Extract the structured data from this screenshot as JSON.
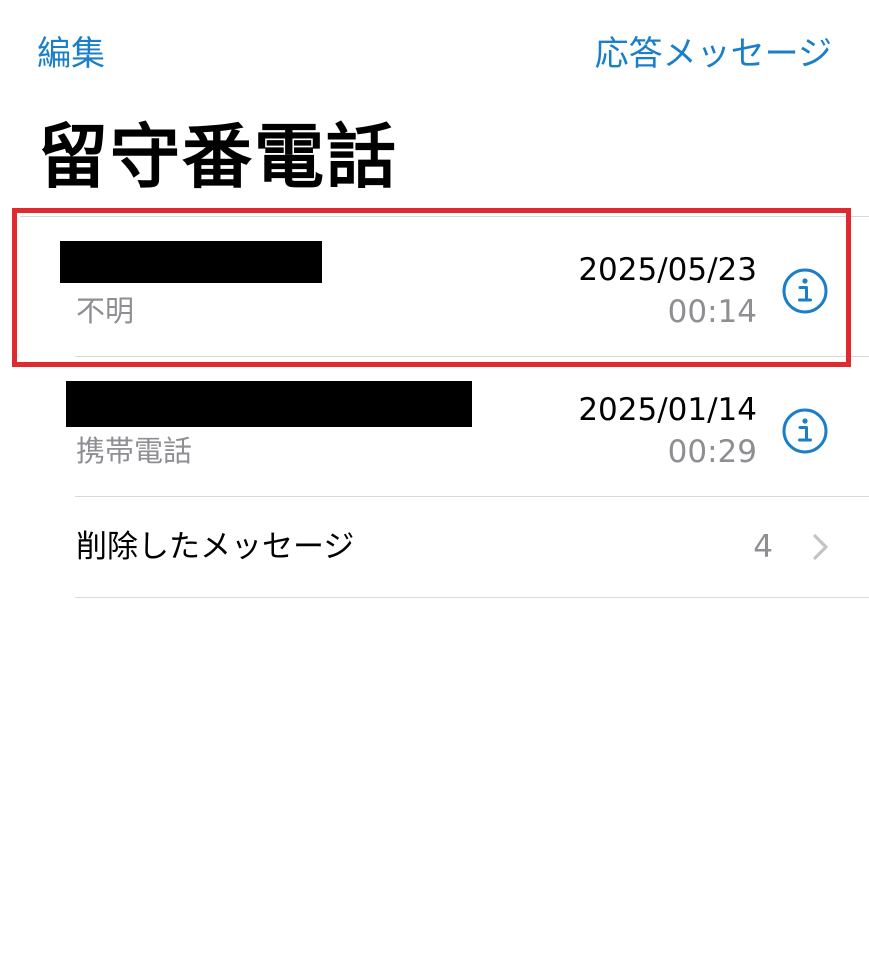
{
  "nav": {
    "edit_label": "編集",
    "greeting_label": "応答メッセージ"
  },
  "title": "留守番電話",
  "voicemails": [
    {
      "caller_redacted": true,
      "subtitle": "不明",
      "date": "2025/05/23",
      "duration": "00:14"
    },
    {
      "caller_redacted": true,
      "subtitle": "携帯電話",
      "date": "2025/01/14",
      "duration": "00:29"
    }
  ],
  "deleted": {
    "label": "削除したメッセージ",
    "count": "4"
  },
  "colors": {
    "accent": "#1a7fc8",
    "secondary_text": "#8e8e93",
    "highlight_border": "#e02a2f",
    "separator": "#d9d9d9"
  },
  "icons": [
    "info-icon",
    "chevron-right-icon"
  ]
}
